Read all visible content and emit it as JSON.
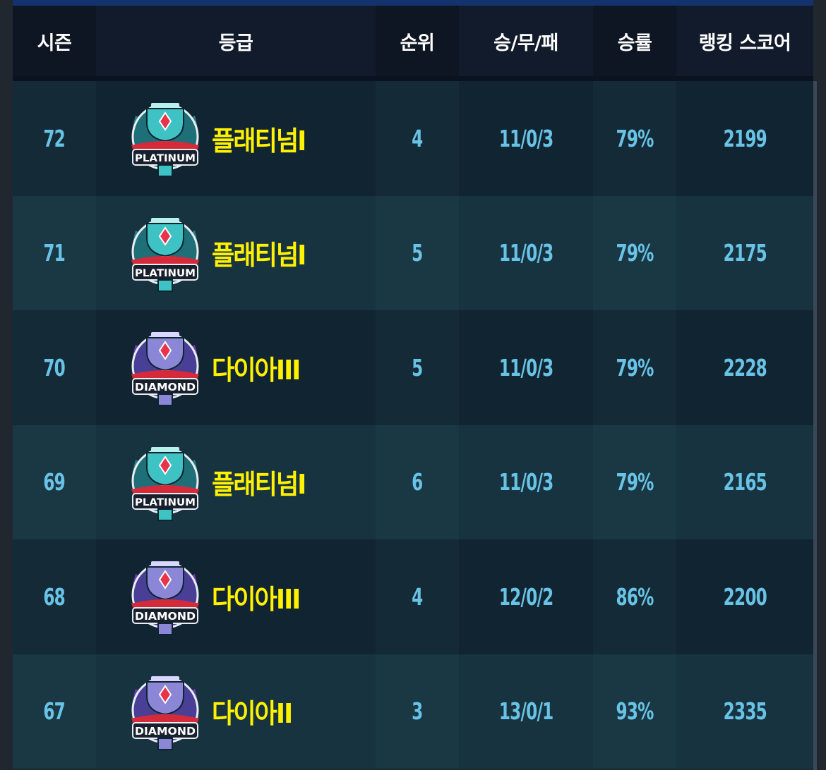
{
  "header": {
    "season": "시즌",
    "grade": "등급",
    "rank": "순위",
    "record": "승/무/패",
    "win_rate": "승률",
    "ranking_score": "랭킹 스코어"
  },
  "colors": {
    "rank_name": "#fff200",
    "numbers": "#68c3e6",
    "header_text": "#ffffff"
  },
  "rows": [
    {
      "season": "72",
      "emblem": "platinum-emblem",
      "emblem_text": "PLATINUM",
      "grade": "플래티넘I",
      "rank": "4",
      "record": "11/0/3",
      "win_rate": "79%",
      "score": "2199"
    },
    {
      "season": "71",
      "emblem": "platinum-emblem",
      "emblem_text": "PLATINUM",
      "grade": "플래티넘I",
      "rank": "5",
      "record": "11/0/3",
      "win_rate": "79%",
      "score": "2175"
    },
    {
      "season": "70",
      "emblem": "diamond-emblem",
      "emblem_text": "DIAMOND",
      "grade": "다이아III",
      "rank": "5",
      "record": "11/0/3",
      "win_rate": "79%",
      "score": "2228"
    },
    {
      "season": "69",
      "emblem": "platinum-emblem",
      "emblem_text": "PLATINUM",
      "grade": "플래티넘I",
      "rank": "6",
      "record": "11/0/3",
      "win_rate": "79%",
      "score": "2165"
    },
    {
      "season": "68",
      "emblem": "diamond-emblem",
      "emblem_text": "DIAMOND",
      "grade": "다이아III",
      "rank": "4",
      "record": "12/0/2",
      "win_rate": "86%",
      "score": "2200"
    },
    {
      "season": "67",
      "emblem": "diamond-emblem",
      "emblem_text": "DIAMOND",
      "grade": "다이아II",
      "rank": "3",
      "record": "13/0/1",
      "win_rate": "93%",
      "score": "2335"
    }
  ]
}
